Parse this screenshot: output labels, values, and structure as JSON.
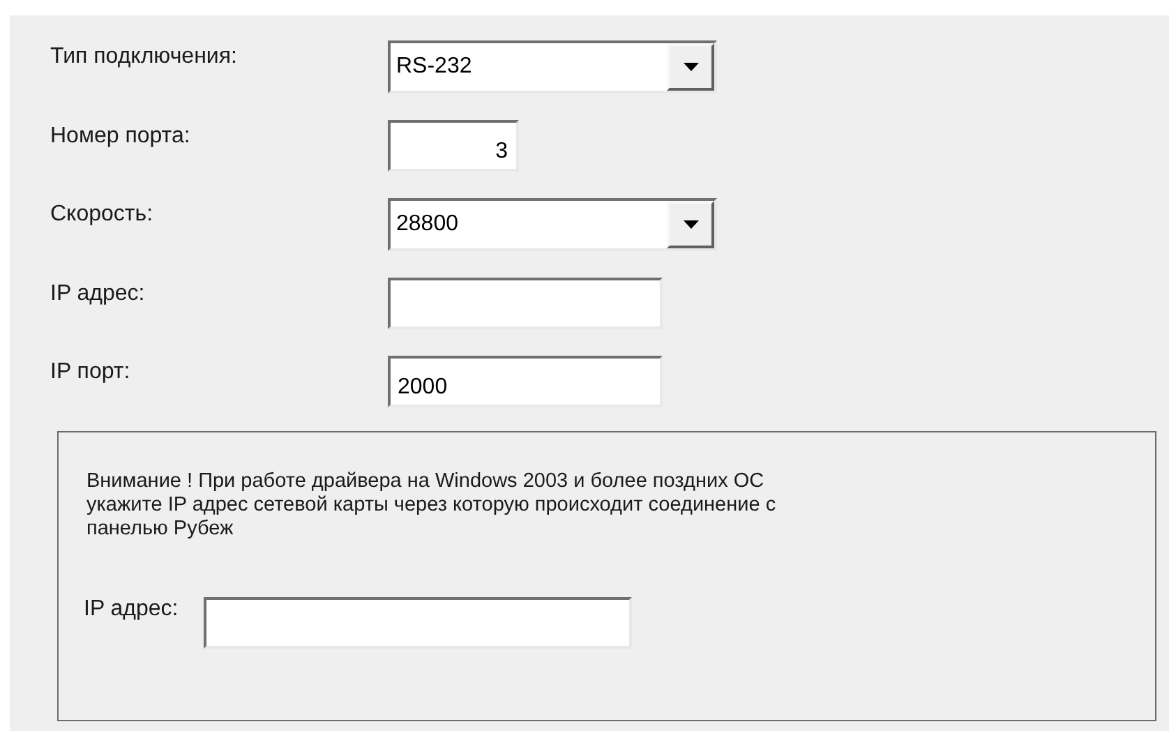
{
  "fields": [
    {
      "kind": "combo",
      "label": "Тип подключения:",
      "value": "RS-232"
    },
    {
      "kind": "input",
      "label": "Номер порта:",
      "value": "3"
    },
    {
      "kind": "combo",
      "label": "Скорость:",
      "value": "28800"
    },
    {
      "kind": "input",
      "label": "IP адрес:"
    },
    {
      "kind": "input",
      "label": "IP порт:",
      "value": "2000"
    }
  ],
  "notice": {
    "text": "Внимание ! При работе драйвера на Windows 2003 и более поздних ОС укажите IP адрес сетевой карты через которую происходит соединение с панелью Рубеж",
    "field_label": "IP адрес:"
  }
}
